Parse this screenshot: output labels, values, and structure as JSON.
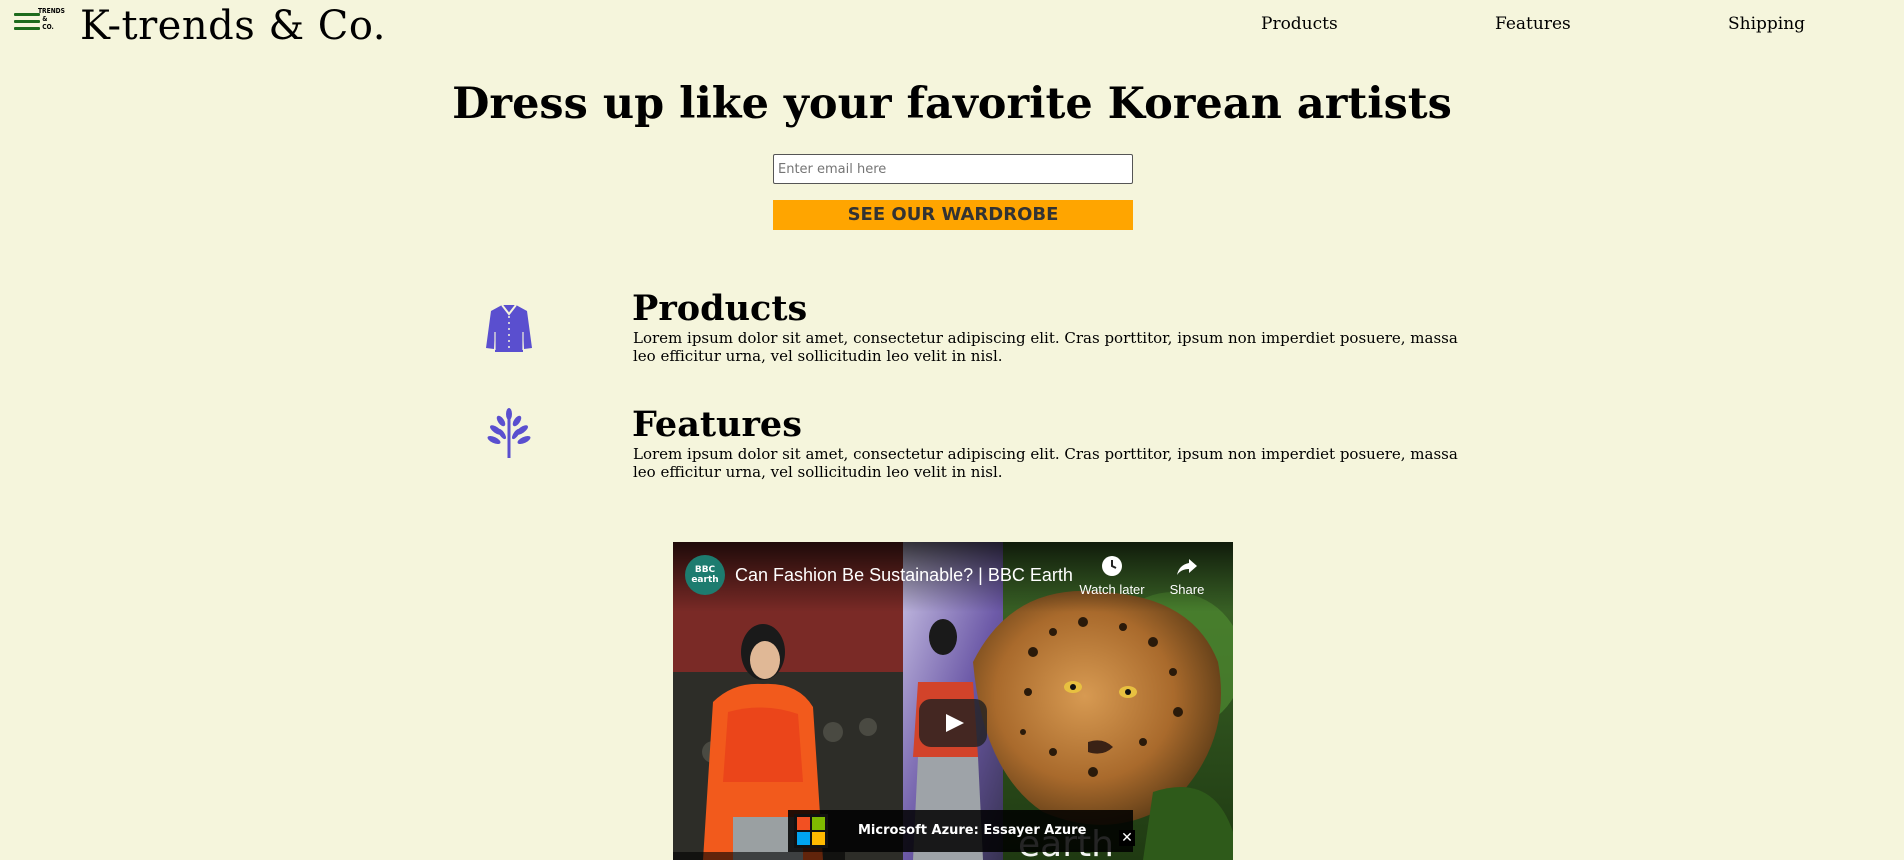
{
  "header": {
    "logo_text": [
      "TRENDS",
      "&",
      "CO."
    ],
    "brand": "K-trends & Co.",
    "nav": {
      "products": "Products",
      "features": "Features",
      "shipping": "Shipping"
    }
  },
  "hero": {
    "title": "Dress up like your favorite Korean artists",
    "email_placeholder": "Enter email here",
    "cta_label": "SEE OUR WARDROBE"
  },
  "features": [
    {
      "icon": "shirt-icon",
      "title": "Products",
      "description": "Lorem ipsum dolor sit amet, consectetur adipiscing elit. Cras porttitor, ipsum non imperdiet posuere, massa leo efficitur urna, vel sollicitudin leo velit in nisl."
    },
    {
      "icon": "tree-icon",
      "title": "Features",
      "description": "Lorem ipsum dolor sit amet, consectetur adipiscing elit. Cras porttitor, ipsum non imperdiet posuere, massa leo efficitur urna, vel sollicitudin leo velit in nisl."
    }
  ],
  "video": {
    "channel_avatar_text": "BBC earth",
    "title": "Can Fashion Be Sustainable? | BBC Earth",
    "watch_later_label": "Watch later",
    "share_label": "Share",
    "ad_text": "Microsoft Azure: Essayer Azure (gratuit)",
    "watermark": "earth"
  },
  "colors": {
    "background": "#f5f5dc",
    "cta": "#ffa500",
    "icon": "#5a4fcf",
    "logo_green": "#1d6b1d"
  }
}
